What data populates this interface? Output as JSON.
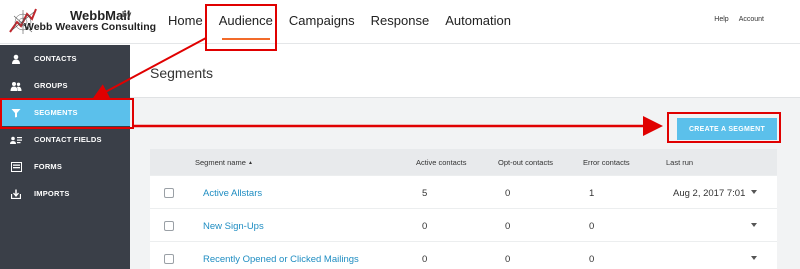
{
  "brand": {
    "name": "WebbMail",
    "by": "by",
    "company": "Webb Weavers Consulting"
  },
  "nav": {
    "items": [
      {
        "label": "Home"
      },
      {
        "label": "Audience"
      },
      {
        "label": "Campaigns"
      },
      {
        "label": "Response"
      },
      {
        "label": "Automation"
      }
    ],
    "help": "Help",
    "account": "Account"
  },
  "sidebar": {
    "items": [
      {
        "label": "CONTACTS",
        "icon": "person-icon"
      },
      {
        "label": "GROUPS",
        "icon": "people-icon"
      },
      {
        "label": "SEGMENTS",
        "icon": "funnel-icon"
      },
      {
        "label": "CONTACT FIELDS",
        "icon": "contact-card-icon"
      },
      {
        "label": "FORMS",
        "icon": "form-icon"
      },
      {
        "label": "IMPORTS",
        "icon": "import-icon"
      }
    ]
  },
  "page": {
    "title": "Segments",
    "create_button": "CREATE A SEGMENT"
  },
  "table": {
    "headers": {
      "name": "Segment name",
      "sort_indicator": "▲",
      "active": "Active contacts",
      "optout": "Opt-out contacts",
      "error": "Error contacts",
      "lastrun": "Last run"
    },
    "rows": [
      {
        "name": "Active Allstars",
        "active": "5",
        "optout": "0",
        "error": "1",
        "lastrun": "Aug 2, 2017 7:01"
      },
      {
        "name": "New Sign-Ups",
        "active": "0",
        "optout": "0",
        "error": "0",
        "lastrun": ""
      },
      {
        "name": "Recently Opened or Clicked Mailings",
        "active": "0",
        "optout": "0",
        "error": "0",
        "lastrun": ""
      }
    ]
  },
  "colors": {
    "accent": "#5bc0eb",
    "sidebar": "#3a3f48",
    "nav_underline": "#f26b2a",
    "link": "#1f8dc2",
    "annotation": "#e00000"
  }
}
